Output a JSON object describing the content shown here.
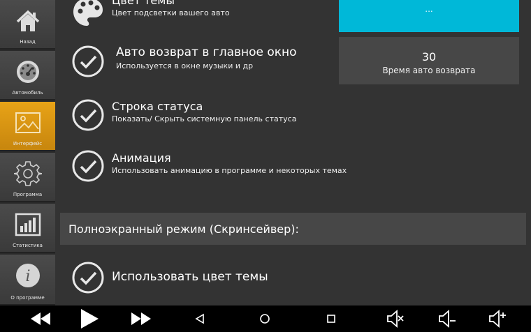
{
  "sidebar": {
    "items": [
      {
        "label": "Назад",
        "icon": "home-icon",
        "active": false
      },
      {
        "label": "Автомобиль",
        "icon": "speedometer-icon",
        "active": false
      },
      {
        "label": "Интерфейс",
        "icon": "image-icon",
        "active": true
      },
      {
        "label": "Программа",
        "icon": "gear-icon",
        "active": false
      },
      {
        "label": "Статистика",
        "icon": "bar-chart-icon",
        "active": false
      },
      {
        "label": "О программе",
        "icon": "info-icon",
        "active": false
      }
    ],
    "active_color": "#e8a317"
  },
  "settings": {
    "theme_color": {
      "title": "Цвет темы",
      "desc": "Цвет подсветки вашего авто",
      "icon": "palette-icon"
    },
    "auto_return": {
      "title": "Авто возврат в главное окно",
      "desc": "Используется в окне музыки и др",
      "checked": true
    },
    "status_bar": {
      "title": "Строка статуса",
      "desc": "Показать/ Скрыть системную панель статуса",
      "checked": true
    },
    "animation": {
      "title": "Анимация",
      "desc": "Использовать анимацию в программе и некоторых темах",
      "checked": true
    },
    "use_theme_color": {
      "title": "Использовать цвет темы",
      "checked": true
    }
  },
  "color_button": {
    "label": "...",
    "color": "#00b8d8"
  },
  "auto_return_time": {
    "value": "30",
    "label": "Время авто возврата"
  },
  "screensaver_section": {
    "title": "Полноэкранный режим (Скринсейвер):"
  },
  "navbar": {
    "icons": [
      "rewind-icon",
      "play-icon",
      "fast-forward-icon",
      "back-icon",
      "home-circle-icon",
      "recents-icon",
      "volume-mute-icon",
      "volume-down-icon",
      "volume-up-icon"
    ]
  }
}
